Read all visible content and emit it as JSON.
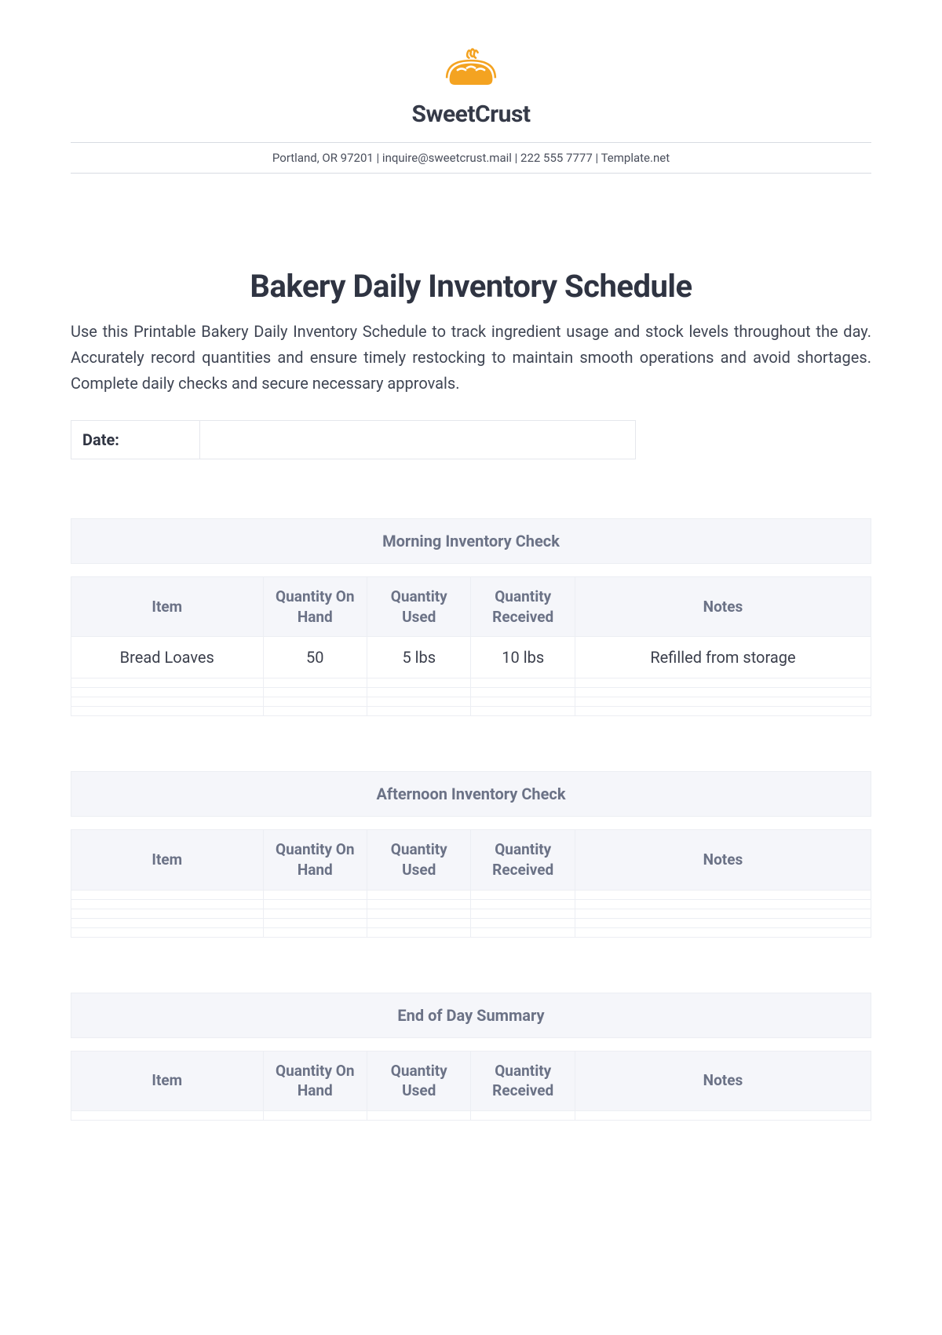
{
  "brand": {
    "name": "SweetCrust"
  },
  "contact_line": "Portland, OR 97201 | inquire@sweetcrust.mail  | 222 555 7777 | Template.net",
  "title": "Bakery Daily Inventory Schedule",
  "intro": "Use this Printable Bakery Daily Inventory Schedule to track ingredient usage and stock levels throughout the day. Accurately record quantities and ensure timely restocking to maintain smooth operations and avoid shortages. Complete daily checks and secure necessary approvals.",
  "date_label": "Date:",
  "headers": {
    "item": "Item",
    "on_hand": "Quantity On Hand",
    "used": "Quantity Used",
    "received": "Quantity Received",
    "notes": "Notes"
  },
  "sections": {
    "morning": {
      "title": "Morning Inventory Check",
      "rows": [
        {
          "item": "Bread Loaves",
          "on_hand": "50",
          "used": "5 lbs",
          "received": "10 lbs",
          "notes": "Refilled from storage"
        }
      ]
    },
    "afternoon": {
      "title": "Afternoon Inventory Check"
    },
    "eod": {
      "title": "End of Day Summary"
    }
  }
}
